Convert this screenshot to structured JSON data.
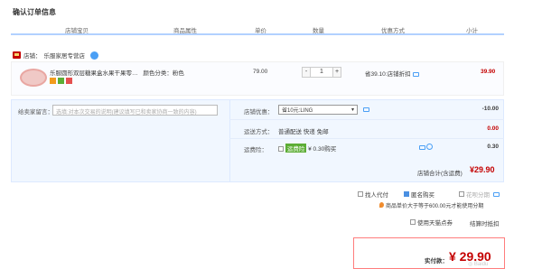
{
  "page_title": "确认订单信息",
  "headers": [
    "店铺宝贝",
    "商品属性",
    "单价",
    "数量",
    "优惠方式",
    "小计"
  ],
  "shop": {
    "label": "店铺：",
    "name": "乐服家居专营店"
  },
  "item": {
    "name": "乐服圆形双层糖果盒水果干果零…",
    "attr": "颜色分类：粉色",
    "price": "79.00",
    "qty_minus": "-",
    "qty": "1",
    "qty_plus": "+",
    "discount": "省39.10:店铺折扣",
    "subtotal": "39.90"
  },
  "message": {
    "label": "给卖家留言：",
    "placeholder": "选填:对本次交易的说明(建议填写已和卖家协商一致的内容)"
  },
  "coupon": {
    "label": "店铺优惠：",
    "value": "省10元:LING",
    "amount": "-10.00"
  },
  "shipping": {
    "label": "运送方式：",
    "value": "普通配送 快递 免邮",
    "amount": "0.00"
  },
  "insurance": {
    "label": "运费险：",
    "tag": "运费险",
    "text": "¥ 0.30购买",
    "amount": "0.30"
  },
  "shop_total": {
    "label": "店铺合计(含运费)",
    "value": "¥29.90"
  },
  "options": {
    "anonymous_label": "找人代付",
    "anonymous_buy_label": "匿名购买",
    "installment_label": "花呗分期",
    "installment_note": "商品单价大于等于600.00元才能使用分期",
    "points_label": "使用天猫点券",
    "points_link": "结算时抵扣"
  },
  "pay": {
    "label": "实付款：",
    "value": "¥ 29.90"
  },
  "colors": {
    "accent": "#c40000",
    "header_line": "#b2d1ff",
    "panel_bg": "#f1f7ff"
  }
}
